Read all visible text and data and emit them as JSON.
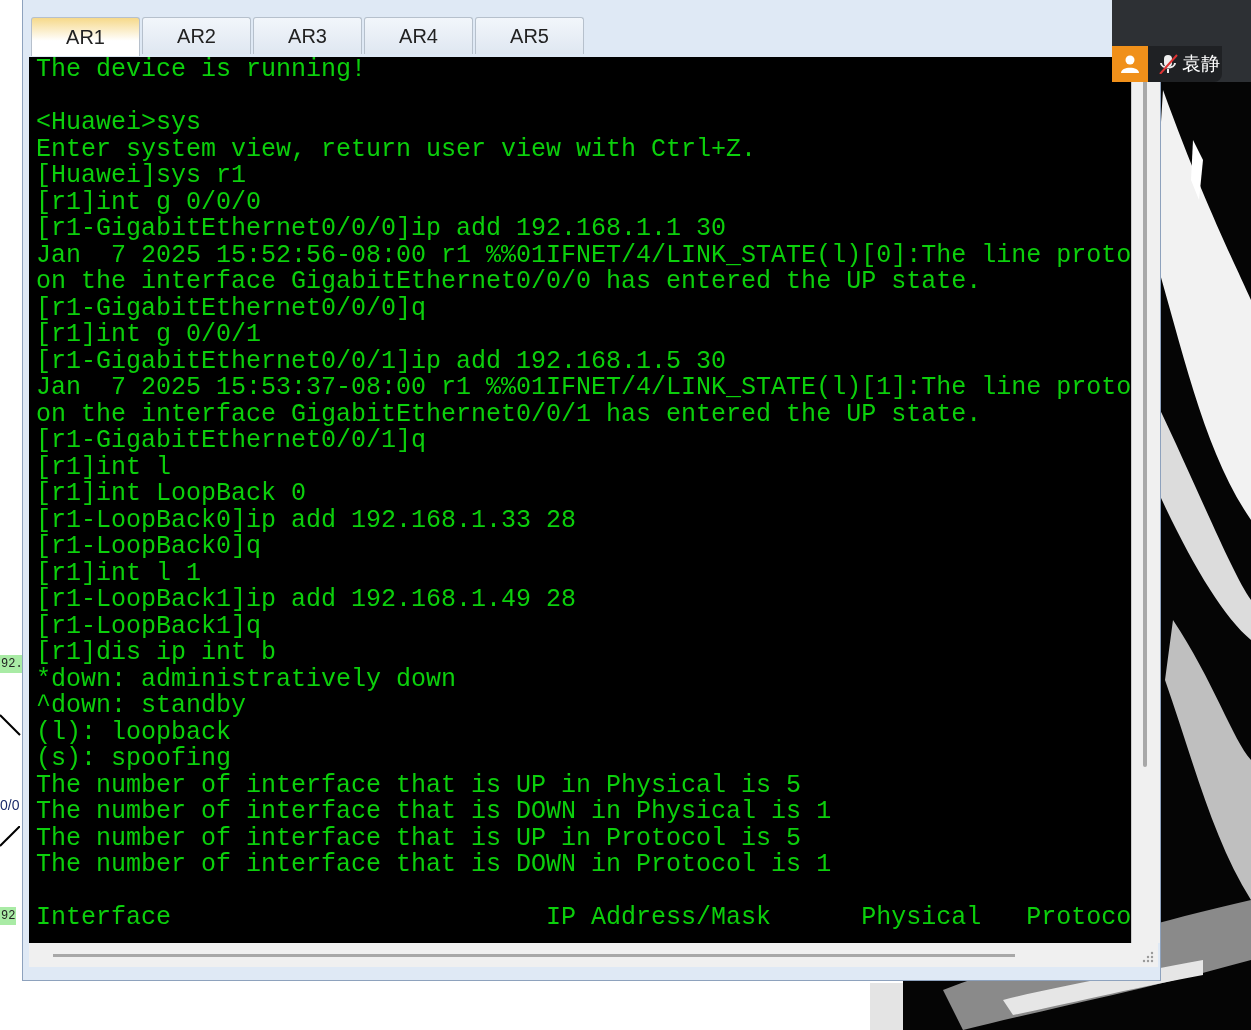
{
  "topology": {
    "labels": [
      {
        "text": "92.",
        "kind": "address"
      },
      {
        "text": "0/0",
        "kind": "port"
      },
      {
        "text": "92",
        "kind": "address"
      }
    ]
  },
  "window": {
    "tabs": [
      {
        "label": "AR1",
        "selected": true
      },
      {
        "label": "AR2",
        "selected": false
      },
      {
        "label": "AR3",
        "selected": false
      },
      {
        "label": "AR4",
        "selected": false
      },
      {
        "label": "AR5",
        "selected": false
      }
    ]
  },
  "terminal": {
    "blocks": [
      [
        "The device is running!"
      ],
      [
        "<Huawei>sys",
        "Enter system view, return user view with Ctrl+Z.",
        "[Huawei]sys r1",
        "[r1]int g 0/0/0",
        "[r1-GigabitEthernet0/0/0]ip add 192.168.1.1 30",
        "Jan  7 2025 15:52:56-08:00 r1 %%01IFNET/4/LINK_STATE(l)[0]:The line proto",
        "on the interface GigabitEthernet0/0/0 has entered the UP state.",
        "[r1-GigabitEthernet0/0/0]q",
        "[r1]int g 0/0/1",
        "[r1-GigabitEthernet0/0/1]ip add 192.168.1.5 30",
        "Jan  7 2025 15:53:37-08:00 r1 %%01IFNET/4/LINK_STATE(l)[1]:The line proto",
        "on the interface GigabitEthernet0/0/1 has entered the UP state.",
        "[r1-GigabitEthernet0/0/1]q",
        "[r1]int l",
        "[r1]int LoopBack 0",
        "[r1-LoopBack0]ip add 192.168.1.33 28",
        "[r1-LoopBack0]q",
        "[r1]int l 1",
        "[r1-LoopBack1]ip add 192.168.1.49 28",
        "[r1-LoopBack1]q",
        "[r1]dis ip int b",
        "*down: administratively down",
        "^down: standby",
        "(l): loopback",
        "(s): spoofing",
        "The number of interface that is UP in Physical is 5",
        "The number of interface that is DOWN in Physical is 1",
        "The number of interface that is UP in Protocol is 5",
        "The number of interface that is DOWN in Protocol is 1"
      ],
      [
        "Interface                         IP Address/Mask      Physical   Protoco"
      ]
    ]
  },
  "call_overlay": {
    "user_name": "袁静",
    "muted": true
  }
}
